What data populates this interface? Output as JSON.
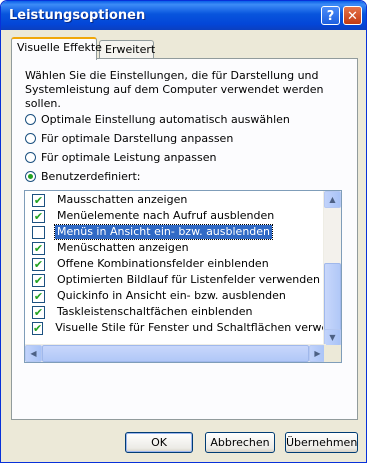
{
  "window": {
    "title": "Leistungsoptionen",
    "help_glyph": "?",
    "close_glyph": "✕"
  },
  "tabs": [
    {
      "label": "Visuelle Effekte",
      "active": true
    },
    {
      "label": "Erweitert",
      "active": false
    }
  ],
  "description": "Wählen Sie die Einstellungen, die für Darstellung und Systemleistung auf dem Computer verwendet werden sollen.",
  "radios": [
    {
      "label": "Optimale Einstellung automatisch auswählen",
      "checked": false
    },
    {
      "label": "Für optimale Darstellung anpassen",
      "checked": false
    },
    {
      "label": "Für optimale Leistung anpassen",
      "checked": false
    },
    {
      "label": "Benutzerdefiniert:",
      "checked": true
    }
  ],
  "effects": [
    {
      "label": "Mausschatten anzeigen",
      "checked": true,
      "selected": false
    },
    {
      "label": "Menüelemente nach Aufruf ausblenden",
      "checked": true,
      "selected": false
    },
    {
      "label": "Menüs in Ansicht ein- bzw. ausblenden",
      "checked": false,
      "selected": true
    },
    {
      "label": "Menüschatten anzeigen",
      "checked": true,
      "selected": false
    },
    {
      "label": "Offene Kombinationsfelder einblenden",
      "checked": true,
      "selected": false
    },
    {
      "label": "Optimierten Bildlauf für Listenfelder verwenden",
      "checked": true,
      "selected": false
    },
    {
      "label": "Quickinfo in Ansicht ein- bzw. ausblenden",
      "checked": true,
      "selected": false
    },
    {
      "label": "Taskleistenschaltfächen einblenden",
      "checked": true,
      "selected": false
    },
    {
      "label": "Visuelle Stile für Fenster und Schaltflächen verwenden",
      "checked": true,
      "selected": false
    }
  ],
  "buttons": {
    "ok": "OK",
    "cancel": "Abbrechen",
    "apply": "Übernehmen"
  },
  "colors": {
    "titlebar": "#0846d8",
    "selection": "#316ac5",
    "check": "#21a121"
  }
}
